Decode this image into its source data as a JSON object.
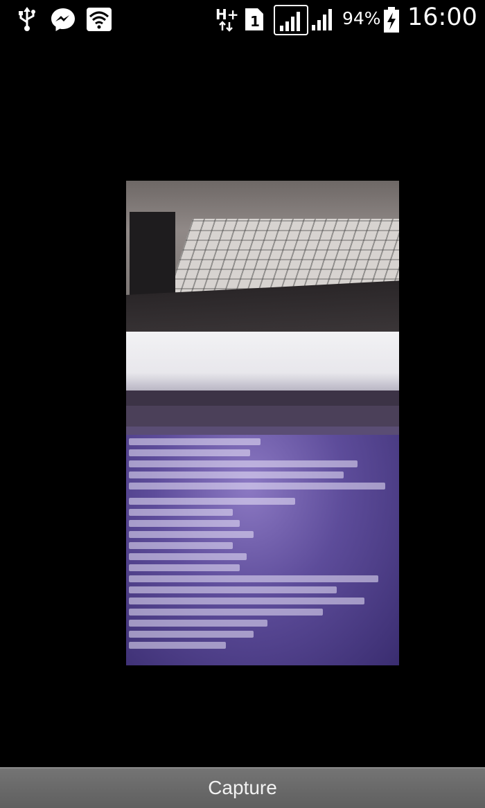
{
  "status_bar": {
    "icons": [
      "usb-icon",
      "messenger-icon",
      "wifi-icon",
      "h-plus-data-icon",
      "sim1-icon",
      "signal-icon",
      "signal-icon"
    ],
    "network_type": "H+",
    "sim_slot": "1",
    "battery_percent": "94%",
    "time": "16:00"
  },
  "camera": {
    "preview": "camera-preview"
  },
  "capture": {
    "label": "Capture"
  },
  "colors": {
    "background": "#000000",
    "capture_bar": "#6a6a6a",
    "status_text": "#ffffff"
  }
}
